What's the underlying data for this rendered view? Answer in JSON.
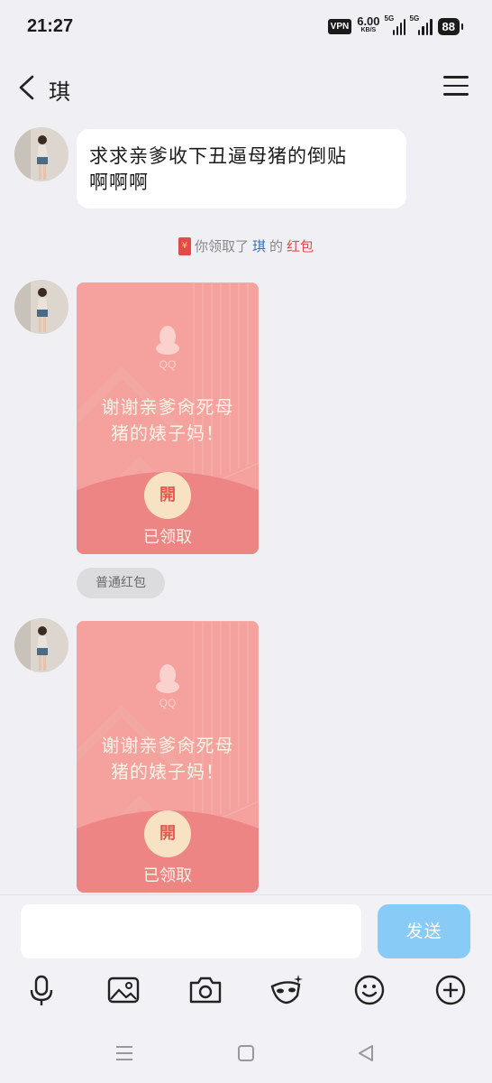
{
  "status_bar": {
    "time": "21:27",
    "vpn": "VPN",
    "net_speed_value": "6.00",
    "net_speed_unit": "KB/S",
    "signal_1": "5G",
    "signal_2": "5G",
    "battery": "88"
  },
  "header": {
    "title": "琪",
    "back_icon": "chevron-left-icon",
    "menu_icon": "hamburger-menu-icon"
  },
  "messages": [
    {
      "type": "text",
      "text_line1": "求求亲爹收下丑逼母猪的倒贴",
      "text_line2": "啊啊啊"
    },
    {
      "type": "system",
      "prefix": "你领取了",
      "name": "琪",
      "middle": "的",
      "highlight": "红包"
    },
    {
      "type": "red_packet",
      "brand": "QQ",
      "line1": "谢谢亲爹肏死母",
      "line2": "猪的婊子妈！",
      "open_label": "開",
      "status": "已领取"
    },
    {
      "type": "tag",
      "label": "普通红包"
    },
    {
      "type": "red_packet",
      "brand": "QQ",
      "line1": "谢谢亲爹肏死母",
      "line2": "猪的婊子妈！",
      "open_label": "開",
      "status": "已领取"
    }
  ],
  "input": {
    "placeholder": "",
    "send_label": "发送"
  },
  "toolbar": {
    "items": [
      "microphone-icon",
      "image-icon",
      "camera-icon",
      "red-packet-mask-icon",
      "emoji-icon",
      "plus-icon"
    ]
  },
  "colors": {
    "background": "#f0f0f4",
    "red_packet": "#f5a19d",
    "send_button": "#88cbf7",
    "link_blue": "#2f6fbf",
    "link_red": "#e34b4b"
  }
}
